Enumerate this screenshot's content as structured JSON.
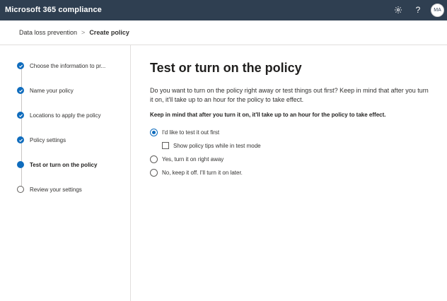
{
  "header": {
    "app_title": "Microsoft 365 compliance",
    "settings_icon": "gear-icon",
    "help_icon": "help-icon",
    "help_glyph": "?",
    "avatar_initials": "MA",
    "bg_color": "#2f3f51"
  },
  "breadcrumb": {
    "parent": "Data loss prevention",
    "separator": ">",
    "current": "Create policy"
  },
  "steps": [
    {
      "label": "Choose the information to pr...",
      "state": "completed"
    },
    {
      "label": "Name your policy",
      "state": "completed"
    },
    {
      "label": "Locations to apply the policy",
      "state": "completed"
    },
    {
      "label": "Policy settings",
      "state": "completed"
    },
    {
      "label": "Test or turn on the policy",
      "state": "current"
    },
    {
      "label": "Review your settings",
      "state": "pending"
    }
  ],
  "main": {
    "title": "Test or turn on the policy",
    "description": "Do you want to turn on the policy right away or test things out first? Keep in mind that after you turn it on, it'll take up to an hour for the policy to take effect.",
    "note": "Keep in mind that after you turn it on, it'll take up to an hour for the policy to take effect.",
    "options": [
      {
        "label": "I'd like to test it out first",
        "selected": true
      },
      {
        "label": "Yes, turn it on right away",
        "selected": false
      },
      {
        "label": "No, keep it off. I'll turn it on later.",
        "selected": false
      }
    ],
    "test_mode_checkbox": {
      "label": "Show policy tips while in test mode",
      "checked": false
    }
  },
  "accent_color": "#0f6cbd"
}
